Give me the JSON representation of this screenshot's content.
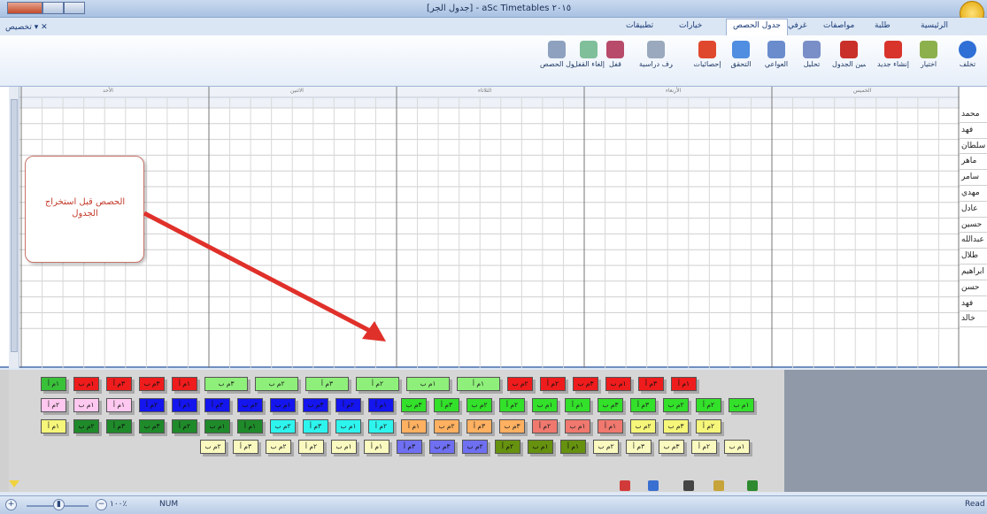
{
  "window": {
    "title": "[جدول الجر] - aSc Timetables ٢٠١٥"
  },
  "ribbon_tabs": [
    {
      "label": "الرئيسية",
      "active": false
    },
    {
      "label": "طلبة",
      "active": false
    },
    {
      "label": "مواصفات",
      "active": false
    },
    {
      "label": "غرفي",
      "active": false
    },
    {
      "label": "جدول الحصص",
      "active": true
    },
    {
      "label": "خيارات",
      "active": false
    },
    {
      "label": "تطبيقات",
      "active": false
    }
  ],
  "customize_label": "تخصيص",
  "ribbon_buttons": [
    {
      "label": "تخلف",
      "color": "#2f6fd6"
    },
    {
      "label": "اختيار",
      "color": "#8bb04c"
    },
    {
      "label": "إنشاء جديد",
      "color": "#d8342c"
    },
    {
      "label": "تحسين الجدول",
      "color": "#c9302a"
    },
    {
      "label": "تحليل",
      "color": "#7a8ec7"
    },
    {
      "label": "العواعي",
      "color": "#6a8ccd"
    },
    {
      "label": "التحقق",
      "color": "#4f8ee0"
    },
    {
      "label": "إحصائيات",
      "color": "#e0482e"
    },
    {
      "label": "تخصيص غرف دراسية",
      "color": "#9aa9bd"
    },
    {
      "label": "قفل",
      "color": "#b84a6a"
    },
    {
      "label": "إلغاء القفل",
      "color": "#7fbf9a"
    },
    {
      "label": "إزالة جدول الحصص",
      "color": "#8ea2bf"
    }
  ],
  "grid": {
    "days": [
      "الأحد",
      "الاثنين",
      "الثلاثاء",
      "الأربعاء",
      "الخميس"
    ],
    "periods_per_day": 9,
    "teachers": [
      "محمد",
      "فهد",
      "سلطان",
      "ماهر",
      "سامر",
      "مهدي",
      "عادل",
      "حسين",
      "عبدالله",
      "طلال",
      "ابراهيم",
      "حسن",
      "فهد",
      "خالد"
    ]
  },
  "callout": {
    "text": "الحصص قبل استخراج الجدول"
  },
  "cards": {
    "rows": [
      [
        {
          "t": "١م أ",
          "c": "#39c139"
        },
        {
          "t": "١م ب",
          "c": "#ee1c1c"
        },
        {
          "t": "٣م أ",
          "c": "#ee1c1c"
        },
        {
          "t": "٣م ب",
          "c": "#ee1c1c"
        },
        {
          "t": "١م أ",
          "c": "#ee1c1c"
        },
        {
          "t": "٣م ب",
          "c": "#8ef07a"
        },
        {
          "t": "٢م ب",
          "c": "#8ef07a"
        },
        {
          "t": "٣م أ",
          "c": "#8ef07a"
        },
        {
          "t": "٢م أ",
          "c": "#8ef07a"
        },
        {
          "t": "١م ب",
          "c": "#8ef07a"
        },
        {
          "t": "١م أ",
          "c": "#8ef07a"
        },
        {
          "t": "٢م ب",
          "c": "#ee1c1c"
        },
        {
          "t": "٢م أ",
          "c": "#ee1c1c"
        },
        {
          "t": "٣م ب",
          "c": "#ee1c1c"
        },
        {
          "t": "١م ب",
          "c": "#ee1c1c"
        },
        {
          "t": "٣م أ",
          "c": "#ee1c1c"
        },
        {
          "t": "١م أ",
          "c": "#ee1c1c"
        }
      ],
      [
        {
          "t": "٢م أ",
          "c": "#ffc8f0"
        },
        {
          "t": "١م ب",
          "c": "#ffc8f0"
        },
        {
          "t": "١م أ",
          "c": "#ffc8f0"
        },
        {
          "t": "٢م أ",
          "c": "#1515ee"
        },
        {
          "t": "١م أ",
          "c": "#1515ee"
        },
        {
          "t": "٣م أ",
          "c": "#1515ee"
        },
        {
          "t": "٢م ب",
          "c": "#1515ee"
        },
        {
          "t": "١م ب",
          "c": "#1515ee"
        },
        {
          "t": "٣م ب",
          "c": "#1515ee"
        },
        {
          "t": "٢م أ",
          "c": "#1515ee"
        },
        {
          "t": "١م أ",
          "c": "#1515ee"
        },
        {
          "t": "٣م ب",
          "c": "#33e02a"
        },
        {
          "t": "٣م أ",
          "c": "#33e02a"
        },
        {
          "t": "٢م ب",
          "c": "#33e02a"
        },
        {
          "t": "٢م أ",
          "c": "#33e02a"
        },
        {
          "t": "١م ب",
          "c": "#33e02a"
        },
        {
          "t": "١م أ",
          "c": "#33e02a"
        },
        {
          "t": "٣م ب",
          "c": "#33e02a"
        },
        {
          "t": "٣م أ",
          "c": "#33e02a"
        },
        {
          "t": "٢م ب",
          "c": "#33e02a"
        },
        {
          "t": "٢م أ",
          "c": "#33e02a"
        },
        {
          "t": "١م ب",
          "c": "#33e02a"
        }
      ],
      [
        {
          "t": "١م أ",
          "c": "#f6f67a"
        },
        {
          "t": "٢م ب",
          "c": "#1f8a2a"
        },
        {
          "t": "٣م أ",
          "c": "#1f8a2a"
        },
        {
          "t": "٣م ب",
          "c": "#1f8a2a"
        },
        {
          "t": "٢م أ",
          "c": "#1f8a2a"
        },
        {
          "t": "١م ب",
          "c": "#1f8a2a"
        },
        {
          "t": "١م أ",
          "c": "#1f8a2a"
        },
        {
          "t": "٢م ب",
          "c": "#2ef4ee"
        },
        {
          "t": "٣م أ",
          "c": "#2ef4ee"
        },
        {
          "t": "١م ب",
          "c": "#2ef4ee"
        },
        {
          "t": "٢م أ",
          "c": "#2ef4ee"
        },
        {
          "t": "١م أ",
          "c": "#ffb060"
        },
        {
          "t": "٢م ب",
          "c": "#ffb060"
        },
        {
          "t": "٣م أ",
          "c": "#ffb060"
        },
        {
          "t": "٣م ب",
          "c": "#ffb060"
        },
        {
          "t": "٢م أ",
          "c": "#f0786e"
        },
        {
          "t": "١م ب",
          "c": "#f0786e"
        },
        {
          "t": "١م أ",
          "c": "#f0786e"
        },
        {
          "t": "٢م ب",
          "c": "#f6f67a"
        },
        {
          "t": "٣م ب",
          "c": "#f6f67a"
        },
        {
          "t": "٢م أ",
          "c": "#f6f67a"
        }
      ],
      [
        {
          "t": "٢م ب",
          "c": "#fafac0"
        },
        {
          "t": "٣م أ",
          "c": "#fafac0"
        },
        {
          "t": "٢م ب",
          "c": "#fafac0"
        },
        {
          "t": "٢م أ",
          "c": "#fafac0"
        },
        {
          "t": "١م ب",
          "c": "#fafac0"
        },
        {
          "t": "١م أ",
          "c": "#fafac0"
        },
        {
          "t": "٣م أ",
          "c": "#6f6ff2"
        },
        {
          "t": "٣م ب",
          "c": "#6f6ff2"
        },
        {
          "t": "٢م ب",
          "c": "#6f6ff2"
        },
        {
          "t": "٢م أ",
          "c": "#66920f"
        },
        {
          "t": "١م ب",
          "c": "#66920f"
        },
        {
          "t": "١م أ",
          "c": "#66920f"
        },
        {
          "t": "٢م ب",
          "c": "#fafac0"
        },
        {
          "t": "٣م أ",
          "c": "#fafac0"
        },
        {
          "t": "٣م ب",
          "c": "#fafac0"
        },
        {
          "t": "٢م أ",
          "c": "#fafac0"
        },
        {
          "t": "١م ب",
          "c": "#fafac0"
        }
      ]
    ]
  },
  "status": {
    "zoom": "١٠٠٪",
    "num": "NUM",
    "ready": "Read"
  }
}
